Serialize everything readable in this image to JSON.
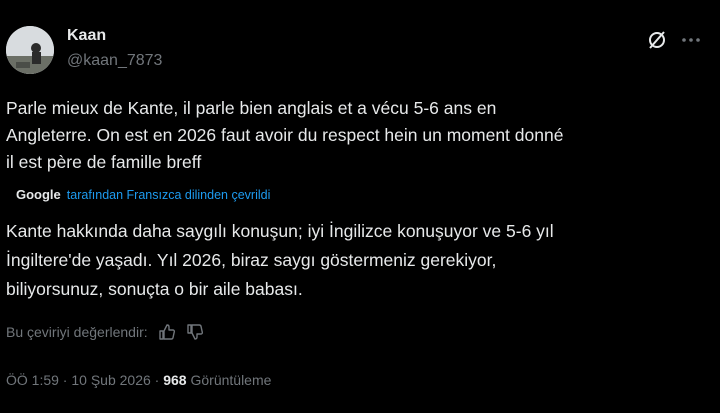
{
  "author": {
    "name": "Kaan",
    "handle": "@kaan_7873"
  },
  "tweet": {
    "text": "Parle mieux de Kante, il parle bien anglais et a vécu 5-6 ans en\nAngleterre. On est en 2026 faut avoir du respect hein un moment donné\nil est père de famille breff"
  },
  "translation": {
    "provider": "Google",
    "note": "tarafından Fransızca dilinden çevrildi",
    "text": "Kante hakkında daha saygılı konuşun; iyi İngilizce konuşuyor ve 5-6 yıl\nİngiltere'de yaşadı. Yıl 2026, biraz saygı göstermeniz gerekiyor,\nbiliyorsunuz, sonuçta o bir aile babası."
  },
  "rating": {
    "label": "Bu çeviriyi değerlendir:"
  },
  "meta": {
    "time": "ÖÖ 1:59",
    "sep1": " · ",
    "date": "10 Şub 2026",
    "sep2": " · ",
    "views_count": "968",
    "views_label": " Görüntüleme"
  },
  "icons": {
    "grok": "grok-icon",
    "more": "more-icon",
    "thumbs_up": "thumbs-up-icon",
    "thumbs_down": "thumbs-down-icon"
  },
  "colors": {
    "background": "#000000",
    "text": "#e7e9ea",
    "secondary": "#71767b",
    "link": "#1d9bf0"
  }
}
